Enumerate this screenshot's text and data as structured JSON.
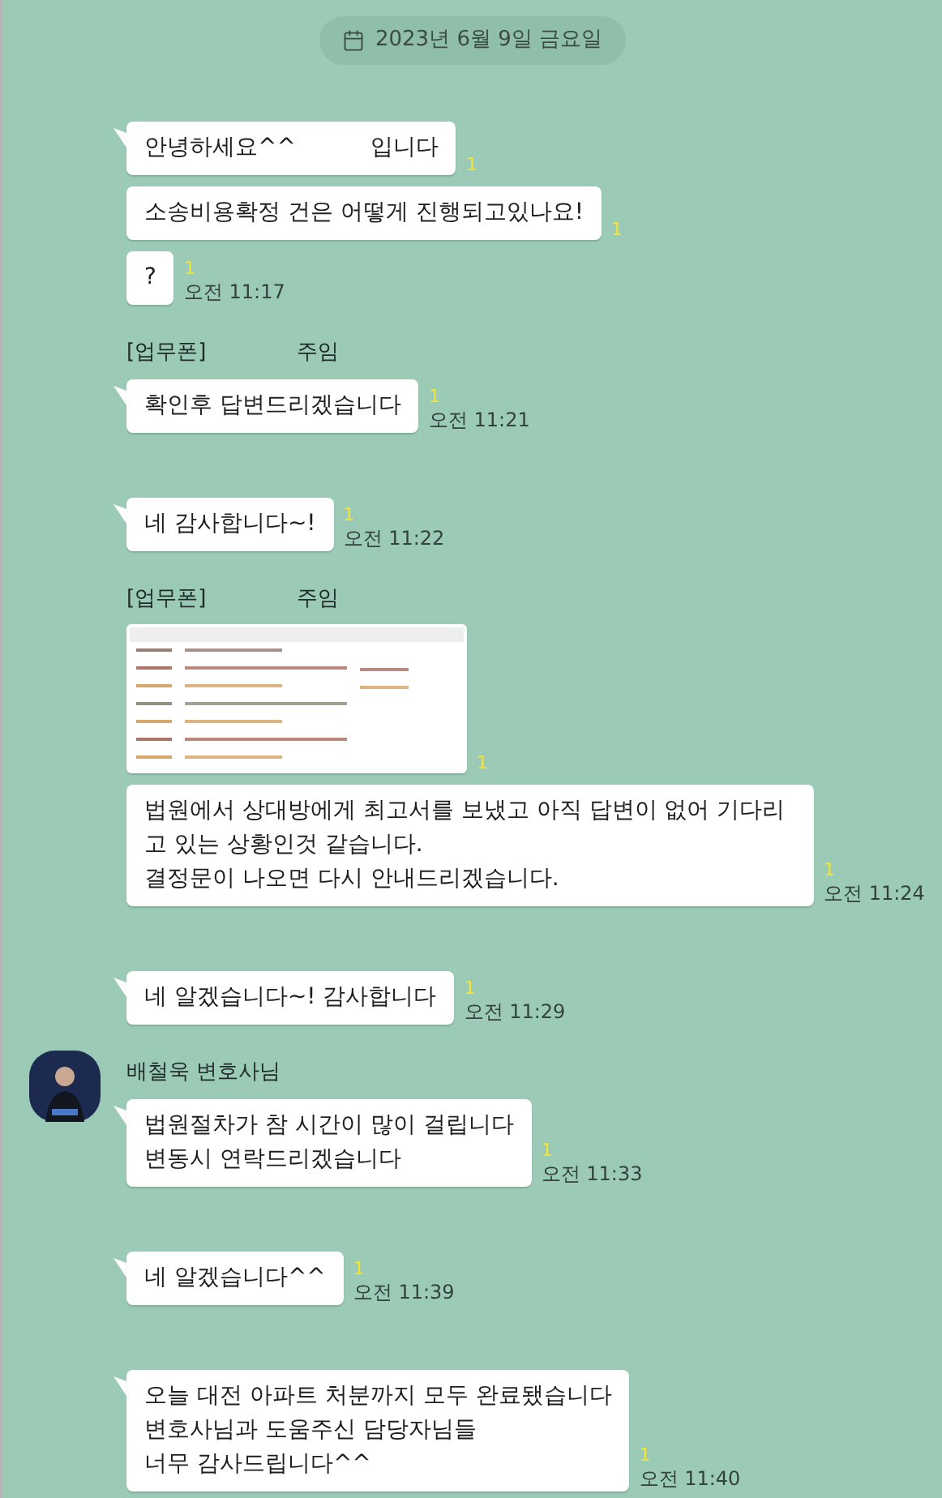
{
  "date_divider": "2023년 6월 9일 금요일",
  "groups": [
    {
      "avatar": false,
      "bubbles": [
        {
          "kind": "gapped",
          "lines": [
            "안녕하세요^^",
            "입니다"
          ],
          "unread": "1"
        },
        {
          "kind": "text",
          "lines": [
            "소송비용확정 건은 어떻게 진행되고있나요!"
          ],
          "unread": "1"
        },
        {
          "kind": "text",
          "lines": [
            "?"
          ],
          "unread": "1",
          "time": "오전 11:17"
        }
      ]
    },
    {
      "avatar": false,
      "sender": [
        "[업무폰]",
        "주임"
      ],
      "bubbles": [
        {
          "kind": "text",
          "lines": [
            "확인후 답변드리겠습니다"
          ],
          "unread": "1",
          "time": "오전 11:21"
        }
      ]
    },
    {
      "avatar": false,
      "bubbles": [
        {
          "kind": "text",
          "lines": [
            "네 감사합니다~!"
          ],
          "unread": "1",
          "time": "오전 11:22"
        }
      ]
    },
    {
      "avatar": false,
      "sender": [
        "[업무폰]",
        "주임"
      ],
      "bubbles": [
        {
          "unread": "1"
        },
        {
          "kind": "text",
          "lines": [
            "법원에서 상대방에게 최고서를 보냈고 아직 답변이 없어 기다리고 있는 상황인것 같습니다.",
            "결정문이 나오면 다시 안내드리겠습니다."
          ],
          "unread": "1",
          "time": "오전 11:24"
        }
      ]
    },
    {
      "avatar": false,
      "bubbles": [
        {
          "kind": "text",
          "lines": [
            "네 알겠습니다~! 감사합니다"
          ],
          "unread": "1",
          "time": "오전 11:29"
        }
      ]
    },
    {
      "avatar": true,
      "sender": [
        "배철욱 변호사님"
      ],
      "bubbles": [
        {
          "kind": "text",
          "lines": [
            "법원절차가 참 시간이 많이 걸립니다",
            "변동시 연락드리겠습니다"
          ],
          "unread": "1",
          "time": "오전 11:33"
        }
      ]
    },
    {
      "avatar": false,
      "bubbles": [
        {
          "kind": "text",
          "lines": [
            "네 알겠습니다^^"
          ],
          "unread": "1",
          "time": "오전 11:39"
        }
      ]
    },
    {
      "avatar": false,
      "bubbles": [
        {
          "kind": "text",
          "lines": [
            "오늘 대전 아파트 처분까지 모두 완료됐습니다",
            "변호사님과 도움주신 담당자님들",
            "너무 감사드립니다^^"
          ],
          "unread": "1",
          "time": "오전 11:40"
        }
      ]
    }
  ]
}
